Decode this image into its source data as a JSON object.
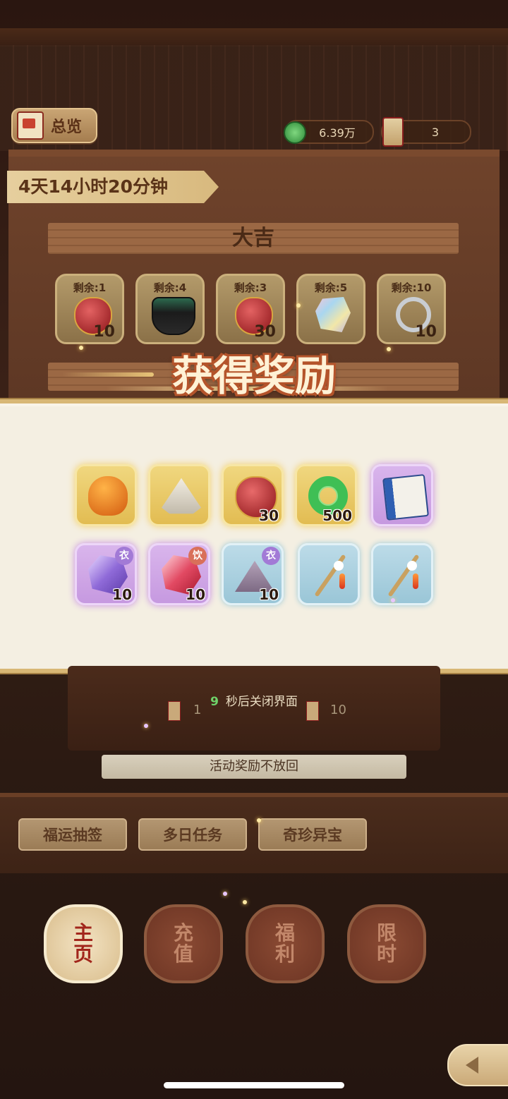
{
  "header": {
    "overview_label": "总览",
    "currency_jade": "6.39万",
    "currency_lots": "3"
  },
  "event": {
    "timer": "4天14小时20分钟",
    "tier_title": "大吉",
    "pool": [
      {
        "label": "剩余:1",
        "count": "10",
        "icon": "red-pouch-icon"
      },
      {
        "label": "剩余:4",
        "count": "",
        "icon": "incense-burner-icon"
      },
      {
        "label": "剩余:3",
        "count": "30",
        "icon": "red-pouch-icon"
      },
      {
        "label": "剩余:5",
        "count": "",
        "icon": "crystal-ore-icon"
      },
      {
        "label": "剩余:10",
        "count": "10",
        "icon": "silver-bracelet-icon"
      }
    ]
  },
  "reward_dialog": {
    "title": "获得奖励",
    "rewards": [
      {
        "rarity": "gold",
        "icon": "amber-stone-icon",
        "count": ""
      },
      {
        "rarity": "gold",
        "icon": "tent-icon",
        "count": ""
      },
      {
        "rarity": "gold",
        "icon": "red-pouch-icon",
        "count": "30"
      },
      {
        "rarity": "gold",
        "icon": "jade-ring-icon",
        "count": "500"
      },
      {
        "rarity": "purple",
        "icon": "book-icon",
        "count": ""
      },
      {
        "rarity": "purple",
        "icon": "purple-crystal-icon",
        "count": "10",
        "tag": "衣"
      },
      {
        "rarity": "purple",
        "icon": "red-crystal-icon",
        "count": "10",
        "tag": "饮"
      },
      {
        "rarity": "blue",
        "icon": "powder-pile-icon",
        "count": "10",
        "tag": "衣"
      },
      {
        "rarity": "blue",
        "icon": "flute-tassel-icon",
        "count": ""
      },
      {
        "rarity": "blue",
        "icon": "flute-tassel-icon",
        "count": ""
      }
    ],
    "countdown_seconds": "9",
    "countdown_text": "秒后关闭界面"
  },
  "table": {
    "left_count": "1",
    "right_count": "10",
    "notice": "活动奖励不放回"
  },
  "tabs": [
    "福运抽签",
    "多日任务",
    "奇珍异宝"
  ],
  "bottom_nav": [
    {
      "line1": "主",
      "line2": "页"
    },
    {
      "line1": "充",
      "line2": "值"
    },
    {
      "line1": "福",
      "line2": "利"
    },
    {
      "line1": "限",
      "line2": "时"
    }
  ],
  "colors": {
    "accent_gold": "#e2bc52",
    "rarity_purple": "#c699e0",
    "rarity_blue": "#9ac6d7",
    "countdown_green": "#6fd36a"
  }
}
